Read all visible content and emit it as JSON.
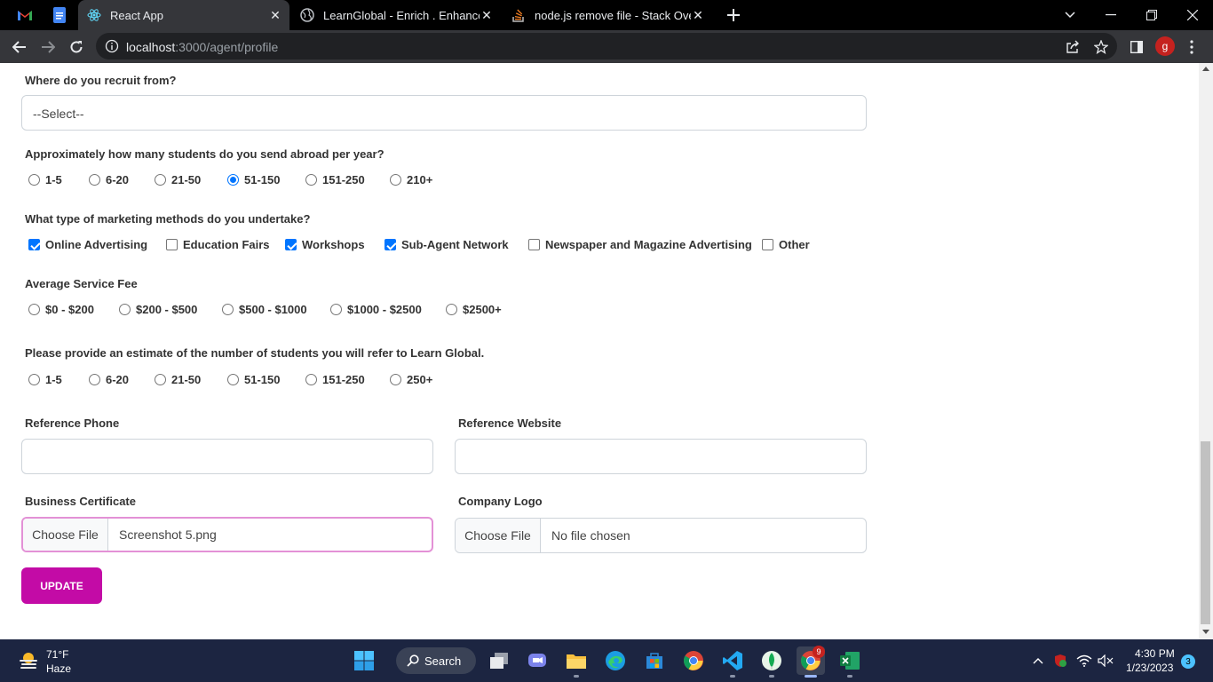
{
  "browser": {
    "tabs": [
      {
        "title": "React App",
        "active": true
      },
      {
        "title": "LearnGlobal - Enrich . Enhance . E",
        "active": false
      },
      {
        "title": "node.js remove file - Stack Overfl",
        "active": false
      }
    ],
    "url_host": "localhost",
    "url_path": ":3000/agent/profile",
    "profile_initial": "g"
  },
  "form": {
    "recruit": {
      "label": "Where do you recruit from?",
      "value": "--Select--"
    },
    "students_abroad": {
      "label": "Approximately how many students do you send abroad per year?",
      "options": [
        "1-5",
        "6-20",
        "21-50",
        "51-150",
        "151-250",
        "210+"
      ],
      "selected": "51-150"
    },
    "marketing": {
      "label": "What type of marketing methods do you undertake?",
      "options": [
        {
          "label": "Online Advertising",
          "checked": true
        },
        {
          "label": "Education Fairs",
          "checked": false
        },
        {
          "label": "Workshops",
          "checked": true
        },
        {
          "label": "Sub-Agent Network",
          "checked": true
        },
        {
          "label": "Newspaper and Magazine Advertising",
          "checked": false
        },
        {
          "label": "Other",
          "checked": false
        }
      ]
    },
    "fee": {
      "label": "Average Service Fee",
      "options": [
        "$0 - $200",
        "$200 - $500",
        "$500 - $1000",
        "$1000 - $2500",
        "$2500+"
      ],
      "selected": null
    },
    "refer": {
      "label": "Please provide an estimate of the number of students you will refer to Learn Global.",
      "options": [
        "1-5",
        "6-20",
        "21-50",
        "51-150",
        "151-250",
        "250+"
      ],
      "selected": null
    },
    "reference_phone": {
      "label": "Reference Phone",
      "value": ""
    },
    "reference_website": {
      "label": "Reference Website",
      "value": ""
    },
    "business_certificate": {
      "label": "Business Certificate",
      "button": "Choose File",
      "file": "Screenshot 5.png"
    },
    "company_logo": {
      "label": "Company Logo",
      "button": "Choose File",
      "file": "No file chosen"
    },
    "submit_label": "UPDATE"
  },
  "taskbar": {
    "weather_temp": "71°F",
    "weather_cond": "Haze",
    "search_label": "Search",
    "time": "4:30 PM",
    "date": "1/23/2023",
    "notification_count": "3",
    "chrome_badge": "9"
  }
}
